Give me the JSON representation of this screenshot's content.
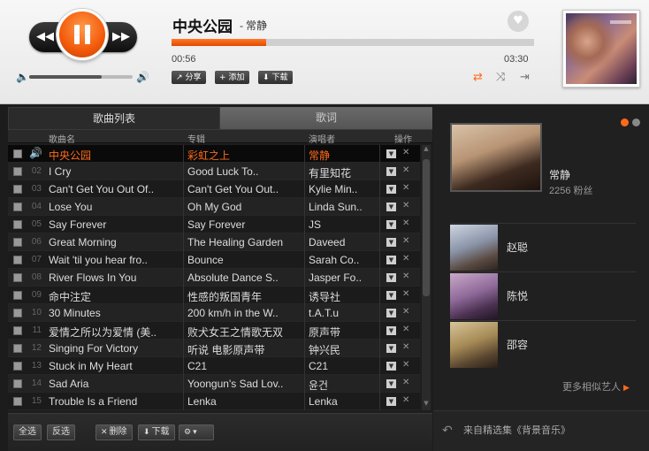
{
  "player": {
    "prev_icon": "◀◀",
    "next_icon": "▶▶",
    "volume_level": 0.7,
    "song_title": "中央公园",
    "song_artist": "常静",
    "artist_dash": "-",
    "heart_icon": "♥",
    "progress": 0.26,
    "time_current": "00:56",
    "time_total": "03:30",
    "share_label": "分享",
    "add_label": "添加",
    "download_label": "下载",
    "modes": [
      "⇄",
      "⤨",
      "⇥"
    ],
    "accent_color": "#ff6a1a"
  },
  "list": {
    "tab_songs": "歌曲列表",
    "tab_lyrics": "歌词",
    "header_title": "歌曲名",
    "header_album": "专辑",
    "header_artist": "演唱者",
    "header_ops": "操作",
    "rows": [
      {
        "num": "",
        "title": "中央公园",
        "album": "彩虹之上",
        "artist": "常静"
      },
      {
        "num": "02",
        "title": "I Cry",
        "album": "Good Luck To..",
        "artist": "有里知花"
      },
      {
        "num": "03",
        "title": "Can't Get You Out Of..",
        "album": "Can't Get You Out..",
        "artist": "Kylie Min.."
      },
      {
        "num": "04",
        "title": "Lose You",
        "album": "Oh My God",
        "artist": "Linda Sun.."
      },
      {
        "num": "05",
        "title": "Say Forever",
        "album": "Say Forever",
        "artist": "JS"
      },
      {
        "num": "06",
        "title": "Great Morning",
        "album": "The Healing Garden",
        "artist": "Daveed"
      },
      {
        "num": "07",
        "title": "Wait 'til you hear fro..",
        "album": "Bounce",
        "artist": "Sarah Co.."
      },
      {
        "num": "08",
        "title": "River Flows In You",
        "album": "Absolute Dance S..",
        "artist": "Jasper Fo.."
      },
      {
        "num": "09",
        "title": "命中注定",
        "album": "性感的叛国青年",
        "artist": "诱导社"
      },
      {
        "num": "10",
        "title": "30 Minutes",
        "album": "200 km/h in the W..",
        "artist": "t.A.T.u"
      },
      {
        "num": "11",
        "title": "爱情之所以为爱情 (美..",
        "album": "败犬女王之情歌无双",
        "artist": "原声带"
      },
      {
        "num": "12",
        "title": "Singing For Victory",
        "album": "听说 电影原声带",
        "artist": "钟兴民"
      },
      {
        "num": "13",
        "title": "Stuck in My Heart",
        "album": "C21",
        "artist": "C21"
      },
      {
        "num": "14",
        "title": "Sad Aria",
        "album": "Yoongun's Sad Lov..",
        "artist": "윤건"
      },
      {
        "num": "15",
        "title": "Trouble Is a Friend",
        "album": "Lenka",
        "artist": "Lenka"
      }
    ],
    "select_all": "全选",
    "invert_select": "反选",
    "delete_label": "删除",
    "download_label": "下载"
  },
  "artist": {
    "name": "常静",
    "fans": "2256 粉丝",
    "similar": [
      {
        "name": "赵聪"
      },
      {
        "name": "陈悦"
      },
      {
        "name": "邵容"
      }
    ],
    "more_label": "更多相似艺人",
    "source_text": "来自精选集《背景音乐》"
  }
}
